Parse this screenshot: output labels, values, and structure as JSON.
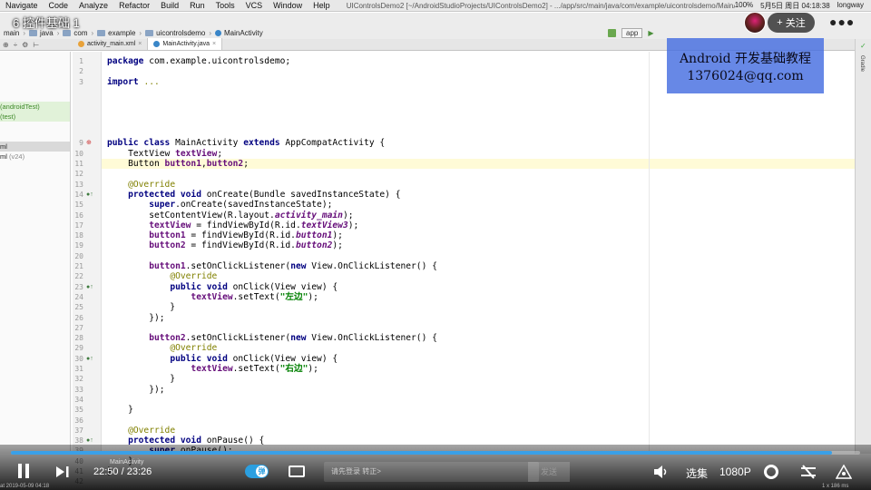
{
  "menubar": {
    "items": [
      "Navigate",
      "Code",
      "Analyze",
      "Refactor",
      "Build",
      "Run",
      "Tools",
      "VCS",
      "Window",
      "Help"
    ],
    "window_title": "UIControlsDemo2 [~/AndroidStudioProjects/UIControlsDemo2] - .../app/src/main/java/com/example/uicontrolsdemo/MainActivity.java [app]",
    "battery": "100%",
    "datetime": "5月5日 周日 04:18:38",
    "user": "longway"
  },
  "video_title": "6 控件基础 1",
  "follow_label": "关注",
  "navbar": {
    "crumbs": [
      "main",
      "java",
      "com",
      "example",
      "uicontrolsdemo",
      "MainActivity"
    ]
  },
  "run_tools": {
    "config": "app"
  },
  "tabs": [
    {
      "label": "activity_main.xml",
      "icon_color": "#e8a23a"
    },
    {
      "label": "MainActivity.java",
      "icon_color": "#3a86c8"
    }
  ],
  "project_tree": [
    {
      "text": "",
      "style": ""
    },
    {
      "text": "",
      "style": ""
    },
    {
      "text": "",
      "style": ""
    },
    {
      "text": "",
      "style": ""
    },
    {
      "text": "",
      "style": ""
    },
    {
      "text": "(androidTest)",
      "style": "test"
    },
    {
      "text": "(test)",
      "style": "test"
    },
    {
      "text": "",
      "style": ""
    },
    {
      "text": "",
      "style": ""
    },
    {
      "text": "ml",
      "style": "sel"
    },
    {
      "text": "ml",
      "dim": "(v24)",
      "style": ""
    }
  ],
  "gutter_marks": [
    {
      "line": 9,
      "mark": "⊕",
      "type": "err"
    },
    {
      "line": 14,
      "mark": "●↑",
      "type": ""
    },
    {
      "line": 23,
      "mark": "●↑",
      "type": ""
    },
    {
      "line": 30,
      "mark": "●↑",
      "type": ""
    },
    {
      "line": 38,
      "mark": "●↑",
      "type": ""
    }
  ],
  "code_lines": [
    "<span class=\"kw\">package</span> com.example.uicontrolsdemo;",
    "",
    "<span class=\"kw\">import</span> <span class=\"ann\">...</span>",
    "",
    "",
    "",
    "",
    "",
    "<span class=\"kw\">public class</span> MainActivity <span class=\"kw\">extends</span> AppCompatActivity {",
    "    TextView <span class=\"fld\">textView</span>;",
    "    Button <span class=\"fld\">button1</span>,<span class=\"fld\">button2</span>;",
    "",
    "    <span class=\"ann\">@Override</span>",
    "    <span class=\"kw\">protected void</span> onCreate(Bundle savedInstanceState) {",
    "        <span class=\"kw\">super</span>.onCreate(savedInstanceState);",
    "        setContentView(R.layout.<span class=\"fld ital\">activity_main</span>);",
    "        <span class=\"fld\">textView</span> = findViewById(R.id.<span class=\"fld ital\">textView3</span>);",
    "        <span class=\"fld\">button1</span> = findViewById(R.id.<span class=\"fld ital\">button1</span>);",
    "        <span class=\"fld\">button2</span> = findViewById(R.id.<span class=\"fld ital\">button2</span>);",
    "",
    "        <span class=\"fld\">button1</span>.setOnClickListener(<span class=\"kw\">new</span> View.OnClickListener() {",
    "            <span class=\"ann\">@Override</span>",
    "            <span class=\"kw\">public void</span> onClick(View view) {",
    "                <span class=\"fld\">textView</span>.setText(<span class=\"str\">\"左边\"</span>);",
    "            }",
    "        });",
    "",
    "        <span class=\"fld\">button2</span>.setOnClickListener(<span class=\"kw\">new</span> View.OnClickListener() {",
    "            <span class=\"ann\">@Override</span>",
    "            <span class=\"kw\">public void</span> onClick(View view) {",
    "                <span class=\"fld\">textView</span>.setText(<span class=\"str\">\"右边\"</span>);",
    "            }",
    "        });",
    "",
    "    }",
    "",
    "    <span class=\"ann\">@Override</span>",
    "    <span class=\"kw\">protected void</span> onPause() {",
    "        <span class=\"kw\">super</span>.onPause();",
    "    }",
    "}",
    ""
  ],
  "line_numbers": [
    "1",
    "2",
    "3",
    "",
    "",
    "",
    "",
    "",
    "9",
    "10",
    "11",
    "12",
    "13",
    "14",
    "15",
    "16",
    "17",
    "18",
    "19",
    "20",
    "21",
    "22",
    "23",
    "24",
    "25",
    "26",
    "27",
    "28",
    "29",
    "30",
    "31",
    "32",
    "33",
    "34",
    "35",
    "36",
    "37",
    "38",
    "39",
    "40",
    "41",
    "42"
  ],
  "current_line": 11,
  "watermark": {
    "line1": "Android 开发基础教程",
    "line2": "1376024@qq.com"
  },
  "right_strip": {
    "label": "Gradle"
  },
  "player": {
    "progress": 0.967,
    "hover_label": "MainActivity",
    "current_time": "22:50",
    "total_time": "23:26",
    "toggle_label": "弹",
    "danmaku_placeholder": "请先登录 转正>",
    "send_label": "发送",
    "episodes_label": "选集",
    "quality_label": "1080P",
    "accent_color": "#3aa0e8",
    "meta_left": "at 2019-05-09 04:18",
    "meta_right": "1 x 186 ms"
  }
}
